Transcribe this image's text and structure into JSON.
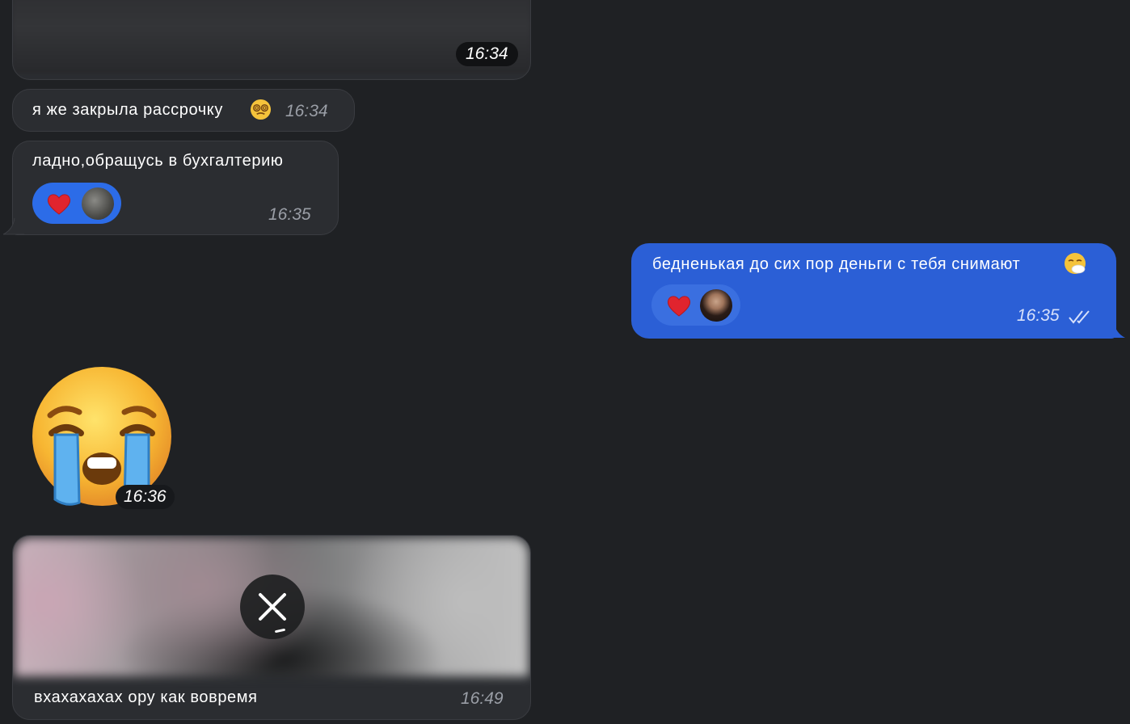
{
  "theme": {
    "background": "#1f2124",
    "incoming_bubble": "#2b2d31",
    "outgoing_bubble": "#2b5fd6",
    "reaction_incoming": "#2c6ce8",
    "reaction_outgoing": "#3a6fe0"
  },
  "messages": [
    {
      "kind": "media",
      "direction": "in",
      "time": "16:34"
    },
    {
      "kind": "text",
      "direction": "in",
      "text": "я же закрыла рассрочку",
      "emoji": "dizzy-face",
      "time": "16:34"
    },
    {
      "kind": "text",
      "direction": "in",
      "text": "ладно,обращусь в бухгалтерию",
      "reaction": "red-heart",
      "time": "16:35"
    },
    {
      "kind": "text",
      "direction": "out",
      "text": "бедненькая до сих пор деньги с тебя снимают",
      "emoji": "sneezing-face",
      "reaction": "red-heart",
      "time": "16:35",
      "status": "read"
    },
    {
      "kind": "sticker",
      "direction": "in",
      "emoji": "loudly-crying-face",
      "time": "16:36"
    },
    {
      "kind": "media-caption",
      "direction": "in",
      "text": "вхахахахах ору как вовремя",
      "time": "16:49",
      "media_state": "blurred",
      "action_icon": "close-icon"
    }
  ]
}
